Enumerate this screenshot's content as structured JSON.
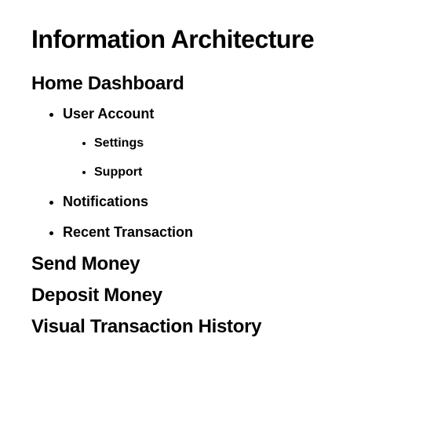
{
  "title": "Information Architecture",
  "sections": {
    "home": {
      "heading": "Home Dashboard",
      "items": [
        {
          "label": "User Account",
          "children": [
            {
              "label": "Settings"
            },
            {
              "label": "Support"
            }
          ]
        },
        {
          "label": "Notifications"
        },
        {
          "label": "Recent Transaction"
        }
      ]
    },
    "send": {
      "heading": "Send Money"
    },
    "deposit": {
      "heading": "Deposit Money"
    },
    "history": {
      "heading": "Visual Transaction History"
    }
  }
}
